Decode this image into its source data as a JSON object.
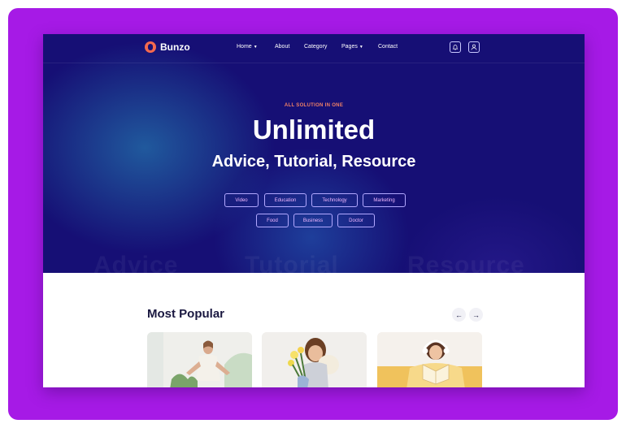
{
  "brand": {
    "name": "Bunzo"
  },
  "nav": {
    "items": [
      {
        "label": "Home",
        "has_dropdown": true
      },
      {
        "label": "About",
        "has_dropdown": false
      },
      {
        "label": "Category",
        "has_dropdown": false
      },
      {
        "label": "Pages",
        "has_dropdown": true
      },
      {
        "label": "Contact",
        "has_dropdown": false
      }
    ],
    "icons": [
      "bell-icon",
      "user-icon"
    ]
  },
  "hero": {
    "eyebrow": "ALL SOLUTION IN ONE",
    "title": "Unlimited",
    "subtitle": "Advice, Tutorial, Resource",
    "tags_row1": [
      "Video",
      "Education",
      "Technology",
      "Marketing"
    ],
    "tags_row2": [
      "Food",
      "Business",
      "Doctor"
    ],
    "watermark": [
      "Advice",
      "Tutorial",
      "Resource"
    ]
  },
  "popular": {
    "title": "Most Popular",
    "prev_icon": "arrow-left-icon",
    "next_icon": "arrow-right-icon",
    "prev_label": "←",
    "next_label": "→"
  },
  "colors": {
    "frame": "#a61ae6",
    "hero_bg": "#160f75",
    "accent": "#f4694e",
    "tag_text": "#f1b8ff",
    "heading_dark": "#1a1840"
  }
}
